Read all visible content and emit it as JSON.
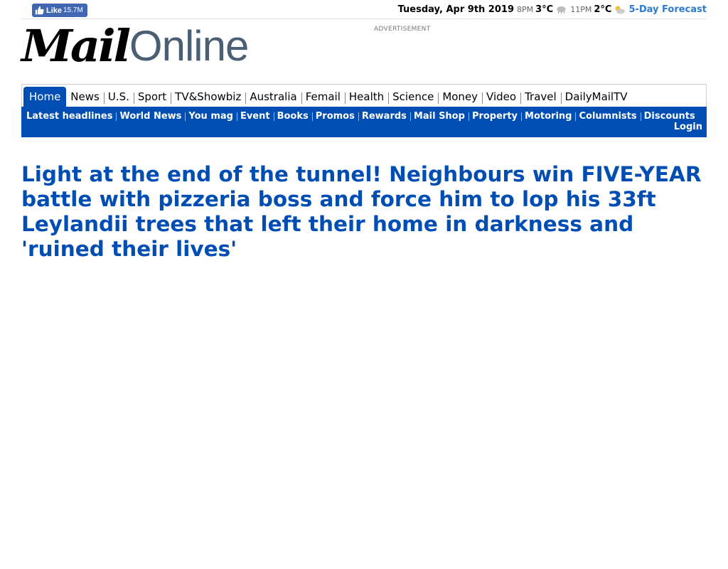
{
  "topbar": {
    "like_label": "Like",
    "like_count": "15.7M",
    "date": "Tuesday, Apr 9th 2019",
    "slots": [
      {
        "time": "8PM",
        "temp": "3°C",
        "icon": "cloud-icon"
      },
      {
        "time": "11PM",
        "temp": "2°C",
        "icon": "partly-cloudy-icon"
      }
    ],
    "forecast_link": "5-Day Forecast"
  },
  "masthead": {
    "logo_mail": "Mail",
    "logo_online": "Online",
    "advert_label": "ADVERTISEMENT"
  },
  "colors": {
    "brand_blue": "#004db3",
    "link_blue": "#2d7ad3"
  },
  "nav": {
    "primary": [
      "Home",
      "News",
      "U.S.",
      "Sport",
      "TV&Showbiz",
      "Australia",
      "Femail",
      "Health",
      "Science",
      "Money",
      "Video",
      "Travel",
      "DailyMailTV"
    ],
    "active": "Home",
    "secondary": [
      "Latest headlines",
      "World News",
      "You mag",
      "Event",
      "Books",
      "Promos",
      "Rewards",
      "Mail Shop",
      "Property",
      "Motoring",
      "Columnists",
      "Discounts"
    ],
    "login": "Login"
  },
  "article": {
    "headline": "Light at the end of the tunnel! Neighbours win FIVE-YEAR battle with pizzeria boss and force him to lop his 33ft Leylandii trees that left their home in darkness and 'ruined their lives'"
  }
}
